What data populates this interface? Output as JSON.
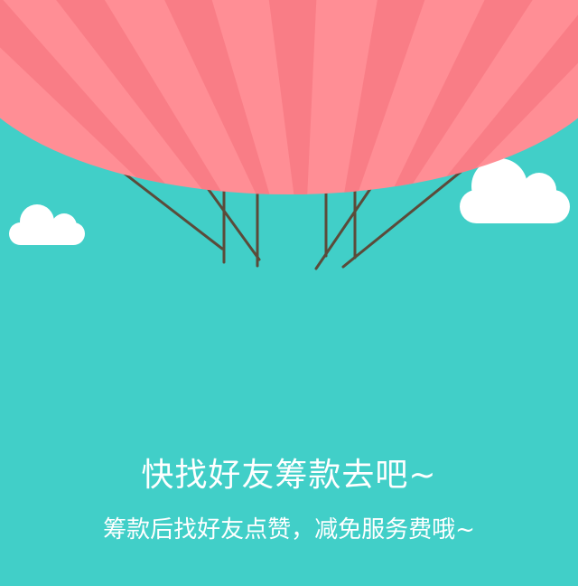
{
  "colors": {
    "background": "#41cfc8",
    "balloon_stripe_light": "#ff8e95",
    "balloon_stripe_dark": "#f97d86",
    "rope": "#5b4b3a",
    "cloud": "#ffffff",
    "text": "#ffffff"
  },
  "illustration": {
    "balloon_icon": "hot-air-balloon-icon",
    "cloud_icon": "cloud-icon"
  },
  "message": {
    "title": "快找好友筹款去吧~",
    "subtitle": "筹款后找好友点赞，减免服务费哦~"
  }
}
